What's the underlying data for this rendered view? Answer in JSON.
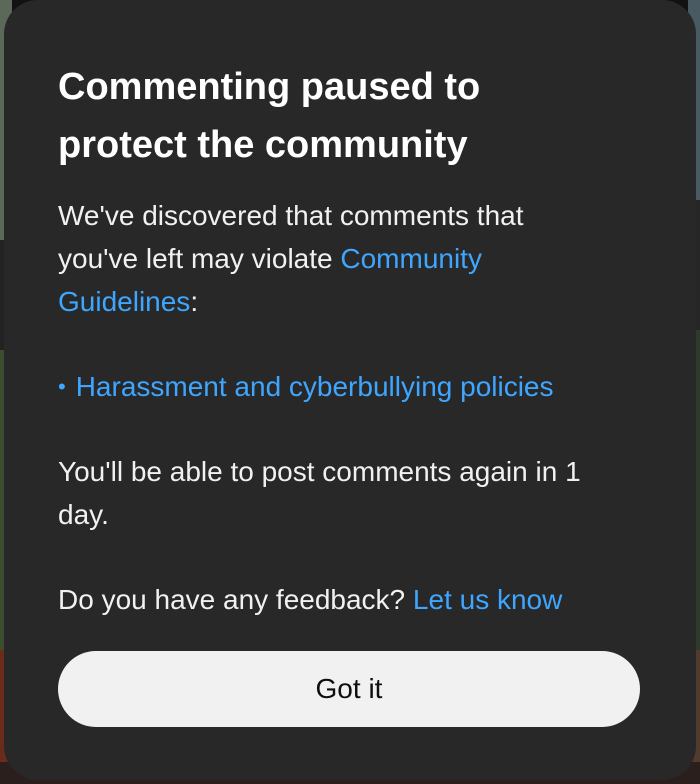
{
  "dialog": {
    "title": "Commenting paused to protect the community",
    "intro_text": "We've discovered that comments that you've left may violate ",
    "guidelines_link": "Community Guidelines",
    "intro_suffix": ":",
    "bullet_icon": "•",
    "policy_link": "Harassment and cyberbullying policies",
    "repost_text": "You'll be able to post comments again in 1 day.",
    "feedback_prefix": "Do you have any feedback? ",
    "feedback_link": "Let us know",
    "button_label": "Got it"
  },
  "colors": {
    "dialog_background": "#282828",
    "link": "#3ea6ff",
    "button_background": "#f1f1f1",
    "text": "#f1f1f1"
  }
}
